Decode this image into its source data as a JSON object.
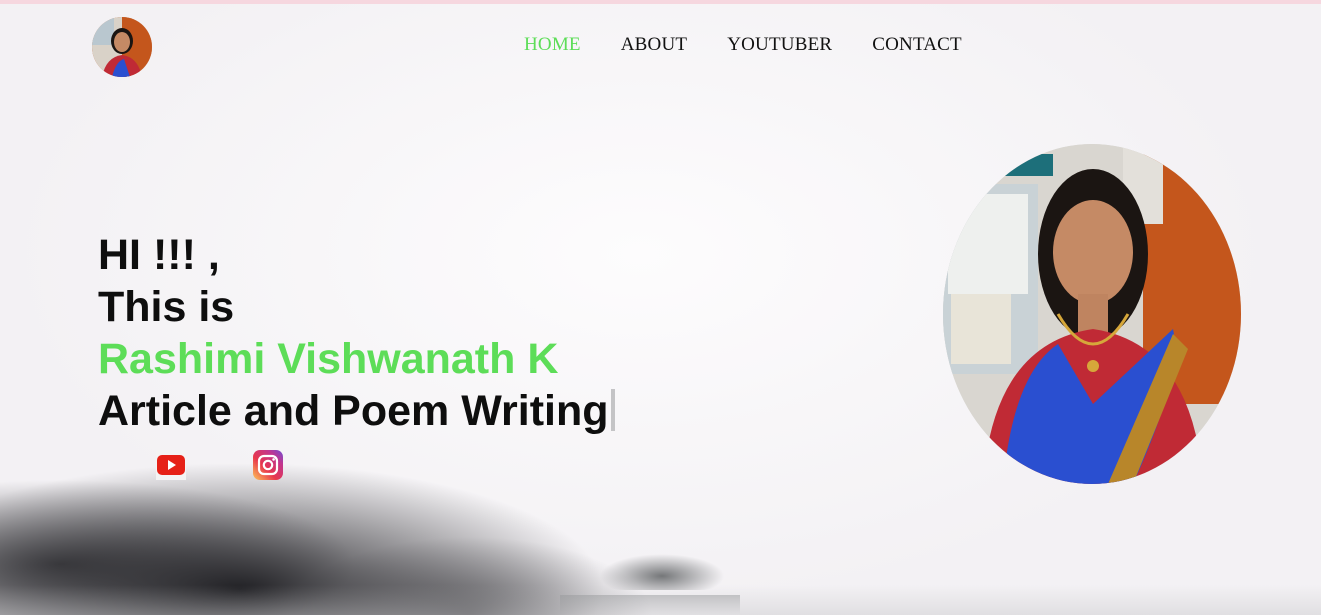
{
  "nav": {
    "items": [
      {
        "label": "HOME",
        "active": true
      },
      {
        "label": "ABOUT",
        "active": false
      },
      {
        "label": "YOUTUBER",
        "active": false
      },
      {
        "label": "CONTACT",
        "active": false
      }
    ]
  },
  "hero": {
    "greeting": "HI !!! ,",
    "intro": "This is",
    "name": "Rashimi Vishwanath K",
    "role": "Article and Poem Writing"
  },
  "social": {
    "links": [
      {
        "icon": "youtube-icon"
      },
      {
        "icon": "instagram-icon"
      }
    ]
  },
  "colors": {
    "accent": "#5ddd58",
    "text": "#0e0e0e",
    "youtube": "#e62117",
    "saree_blue": "#2a4fd0",
    "saree_red": "#c02a35"
  }
}
